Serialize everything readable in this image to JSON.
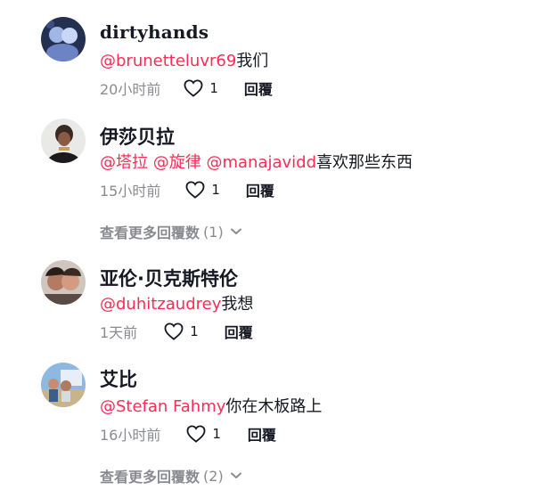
{
  "comments": [
    {
      "username": "dirtyhands",
      "mentions": [
        "@brunetteluvr69"
      ],
      "text": "我们",
      "time": "20小时前",
      "likes": "1",
      "reply_label": "回覆"
    },
    {
      "username": "伊莎贝拉",
      "mentions": [
        "@塔拉",
        "@旋律",
        "@manajavidd"
      ],
      "text": "喜欢那些东西",
      "time": "15小时前",
      "likes": "1",
      "reply_label": "回覆",
      "more_label": "查看更多回覆数",
      "more_count": "(1)"
    },
    {
      "username": "亚伦·贝克斯特伦",
      "mentions": [
        "@duhitzaudrey"
      ],
      "text": "我想",
      "time": "1天前",
      "likes": "1",
      "reply_label": "回覆"
    },
    {
      "username": "艾比",
      "mentions": [
        "@Stefan Fahmy"
      ],
      "text": "你在木板路上",
      "time": "16小时前",
      "likes": "1",
      "reply_label": "回覆",
      "more_label": "查看更多回覆数",
      "more_count": "(2)"
    }
  ],
  "icons": {
    "like": "heart-outline-icon",
    "expand": "chevron-down-icon"
  },
  "colors": {
    "mention": "#fe2c55",
    "meta": "#8a8b91",
    "text": "#161823"
  }
}
